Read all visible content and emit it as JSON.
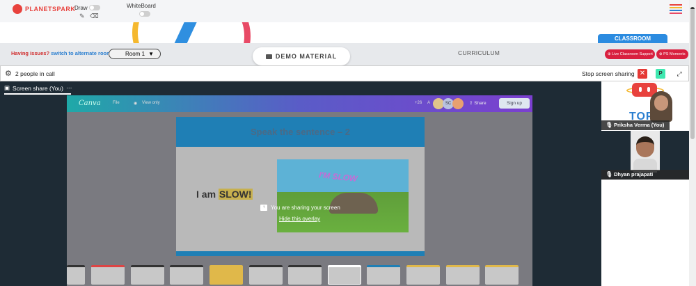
{
  "header": {
    "logo_text": "PLANETSPARK",
    "draw_label": "Draw",
    "whiteboard_label": "WhiteBoard",
    "menu_colors": [
      "#e8423d",
      "#f5b82e",
      "#2b7fd0",
      "#e84a66"
    ]
  },
  "classroom_tab": "CLASSROOM",
  "subbar": {
    "issues_text": "Having issues?",
    "switch_link": "switch to alternate room",
    "room_value": "Room 1",
    "demo_material": "DEMO MATERIAL",
    "curriculum": "CURRICULUM",
    "live_support": "Live Classroom Support",
    "ps_moments": "PS Moments"
  },
  "call": {
    "people_count": "2 people in call",
    "stop_sharing": "Stop screen sharing",
    "p_label": "P"
  },
  "stage": {
    "tab_label": "Screen share (You)",
    "tab_menu": "⋯",
    "canva": {
      "brand": "Canva",
      "file": "File",
      "view_only": "View only",
      "count": "+26",
      "avatar_a": "A",
      "avatar_sc": "SC",
      "share": "Share",
      "signup": "Sign up"
    },
    "slide": {
      "title": "Speak the sentence – 2",
      "sentence_prefix": "I am ",
      "sentence_highlight": "SLOW!",
      "image_text": "I'M SLOW"
    },
    "overlay": {
      "message": "You are sharing your screen",
      "hide": "Hide this overlay"
    }
  },
  "participants": [
    {
      "name": "Priksha Verma (You)"
    },
    {
      "name": "Dhyan prajapati"
    }
  ],
  "colors": {
    "accent": "#2b8be0",
    "danger": "#e53935",
    "brand_red": "#e8423d"
  }
}
